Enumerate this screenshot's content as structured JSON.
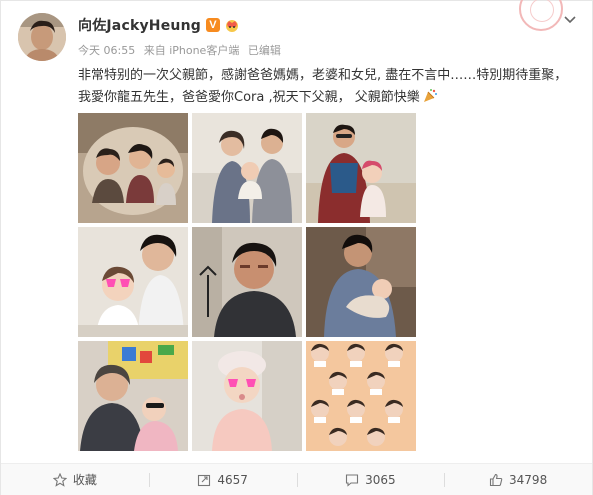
{
  "post": {
    "author": "向佐JackyHeung",
    "verified_badge": "V",
    "time": "今天 06:55",
    "source": "来自 iPhone客户端",
    "edited": "已编辑",
    "text": "非常特别的一次父親節，感謝爸爸媽媽，老婆和女兒, 盡在不言中……特別期待重聚，我愛你龍五先生，爸爸愛你Cora ,祝天下父親， 父親節快樂"
  },
  "photos": [
    {
      "label": "family-car-photo"
    },
    {
      "label": "parents-with-baby-photo"
    },
    {
      "label": "grandpa-with-baby-photo"
    },
    {
      "label": "selfie-with-baby-photo"
    },
    {
      "label": "father-portrait-photo"
    },
    {
      "label": "father-holding-baby-photo"
    },
    {
      "label": "mother-holding-baby-photo"
    },
    {
      "label": "baby-with-hat-photo"
    },
    {
      "label": "collage-pattern-photo"
    }
  ],
  "actions": {
    "favorite": "收藏",
    "repost_count": "4657",
    "comment_count": "3065",
    "like_count": "34798"
  },
  "colors": {
    "accent": "#f78b1f",
    "text": "#333333",
    "meta": "#999999"
  },
  "icons": [
    "chevron-down-icon",
    "verified-icon",
    "crown-icon",
    "party-popper-icon",
    "star-icon",
    "repost-icon",
    "comment-icon",
    "like-icon"
  ]
}
